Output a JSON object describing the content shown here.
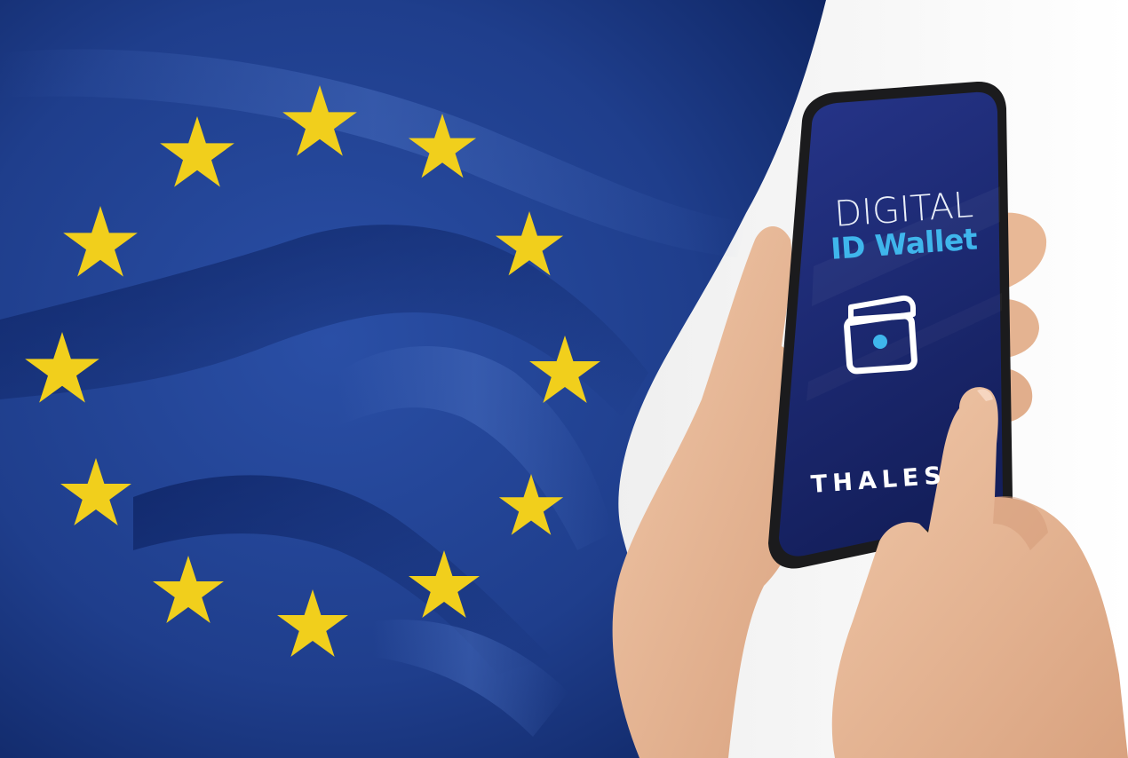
{
  "image": {
    "phone_screen": {
      "title_line1": "DIGITAL",
      "title_line2": "ID Wallet",
      "brand": "THALES",
      "icon": "wallet-icon"
    },
    "colors": {
      "flag_blue": "#1f3e8c",
      "flag_blue_dark": "#102a6b",
      "star_yellow": "#f1cf1c",
      "screen_bg": "#1c2a78",
      "accent_cyan": "#3fb6ec",
      "skin": "#e7b899",
      "phone_frame": "#1b1b1d"
    }
  }
}
